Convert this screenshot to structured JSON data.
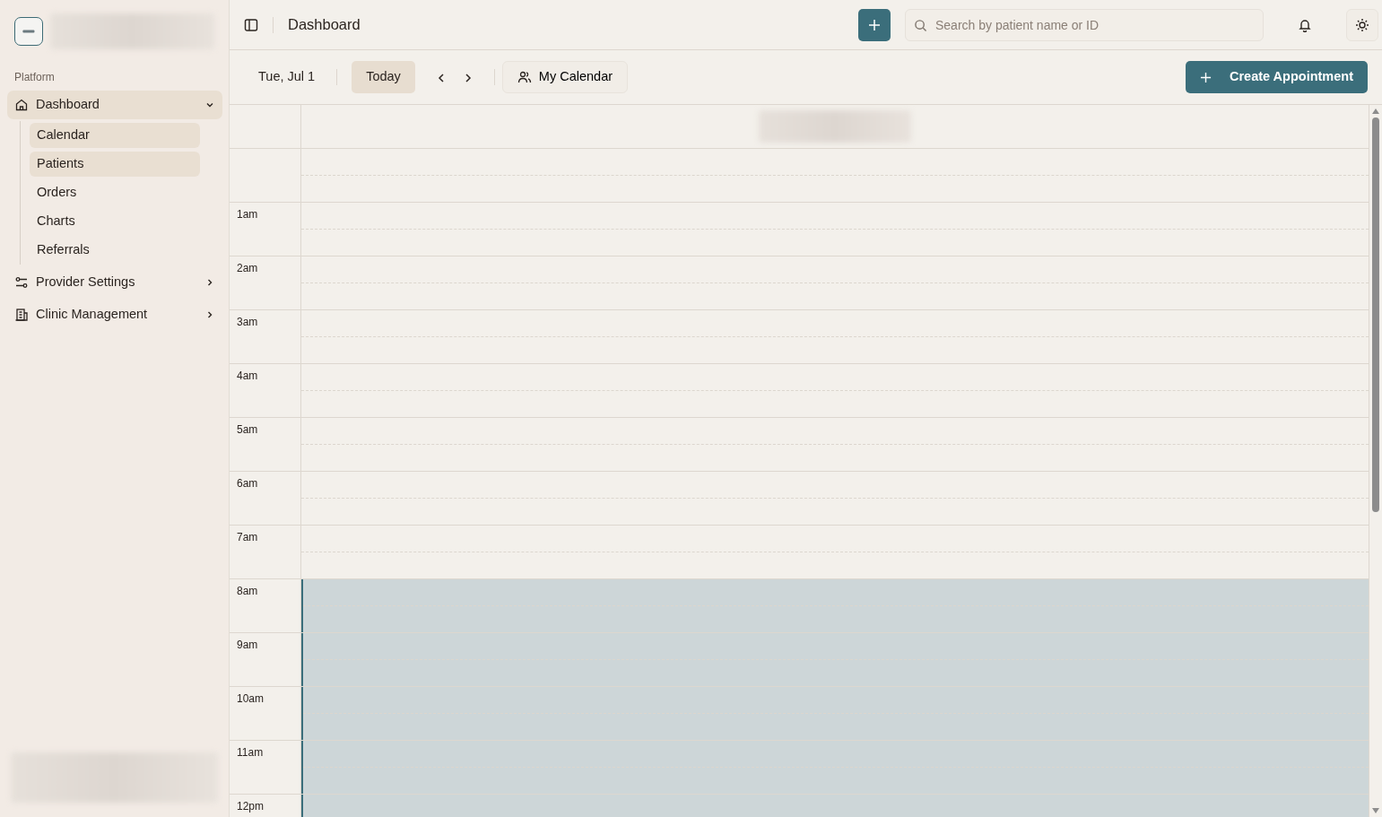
{
  "sidebar": {
    "section_label": "Platform",
    "items": [
      {
        "label": "Dashboard",
        "expanded": true,
        "selected": true,
        "children": [
          {
            "label": "Calendar",
            "selected": true
          },
          {
            "label": "Patients",
            "selected": true
          },
          {
            "label": "Orders",
            "selected": false
          },
          {
            "label": "Charts",
            "selected": false
          },
          {
            "label": "Referrals",
            "selected": false
          }
        ]
      },
      {
        "label": "Provider Settings",
        "expanded": false,
        "selected": false
      },
      {
        "label": "Clinic Management",
        "expanded": false,
        "selected": false
      }
    ]
  },
  "header": {
    "title": "Dashboard",
    "search": {
      "placeholder": "Search by patient name or ID"
    }
  },
  "toolbar": {
    "date": "Tue, Jul 1",
    "today": "Today",
    "calendar_filter": "My Calendar",
    "create_button": "Create Appointment"
  },
  "calendar": {
    "hours": [
      {
        "working": false
      },
      {
        "label": "1am",
        "working": false
      },
      {
        "label": "2am",
        "working": false
      },
      {
        "label": "3am",
        "working": false
      },
      {
        "label": "4am",
        "working": false
      },
      {
        "label": "5am",
        "working": false
      },
      {
        "label": "6am",
        "working": false
      },
      {
        "label": "7am",
        "working": false
      },
      {
        "label": "8am",
        "working": true
      },
      {
        "label": "9am",
        "working": true
      },
      {
        "label": "10am",
        "working": true
      },
      {
        "label": "11am",
        "working": true
      },
      {
        "label": "12pm",
        "working": true
      }
    ]
  }
}
